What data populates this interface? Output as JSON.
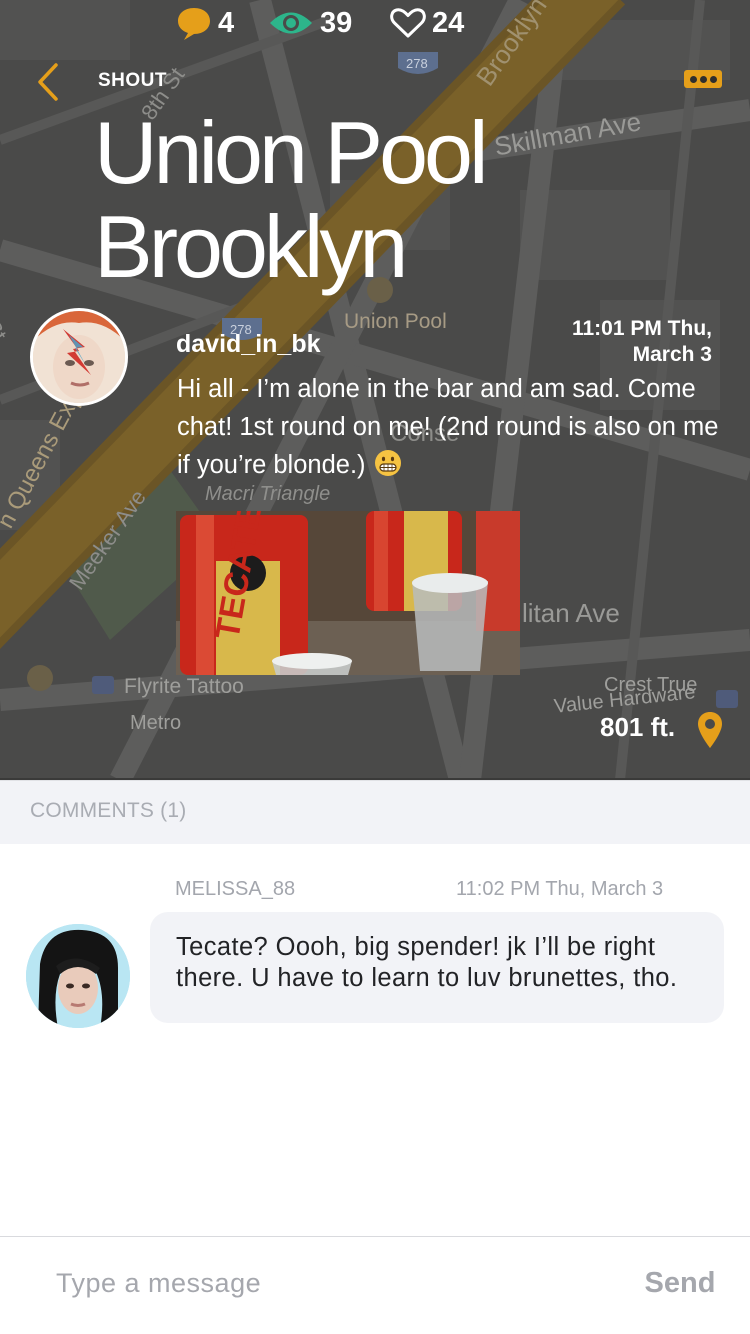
{
  "header": {
    "section_label": "SHOUT",
    "title_line1": "Union Pool",
    "title_line2": "Brooklyn"
  },
  "map": {
    "labels": {
      "skillman": "Skillman Ave",
      "union_pool": "Union Pool",
      "macri": "Macri Triangle",
      "queens": "n Queens Expy",
      "meeker": "Meeker Ave",
      "brooklyn": "Brooklyn",
      "eighth": "8th St",
      "titan": "litan Ave",
      "flyrite": "Flyrite Tattoo",
      "crest": "Crest True",
      "value": "Value Hardware",
      "metro": "Metro",
      "conse": "Conse",
      "st": "St",
      "route_278_a": "278",
      "route_278_b": "278"
    }
  },
  "post": {
    "author": "david_in_bk",
    "time": "11:01 PM Thu, March 3",
    "body": "Hi all - I’m alone in the bar and am sad. Come chat! 1st round on me! (2nd round is also on me if you’re blonde.)",
    "photo_caption": "TECATE",
    "stats": {
      "comments": "4",
      "views": "39",
      "likes": "24"
    },
    "distance": "801 ft."
  },
  "comments": {
    "title": "COMMENTS (1)",
    "items": [
      {
        "user": "MELISSA_88",
        "time": "11:02 PM  Thu, March 3",
        "text": "Tecate? Oooh, big spender! jk I’ll be right there. U have to learn to luv brunettes, tho."
      }
    ]
  },
  "composer": {
    "placeholder": "Type a message",
    "send_label": "Send"
  },
  "colors": {
    "accent": "#e59f1a",
    "eye": "#2db58b",
    "overlay": "#4b4b4a",
    "bubble": "#f2f3f7"
  },
  "icons": [
    "chevron-left-icon",
    "more-dots-icon",
    "comment-bubble-icon",
    "eye-icon",
    "heart-icon",
    "location-pin-icon",
    "grin-emoji-icon"
  ]
}
